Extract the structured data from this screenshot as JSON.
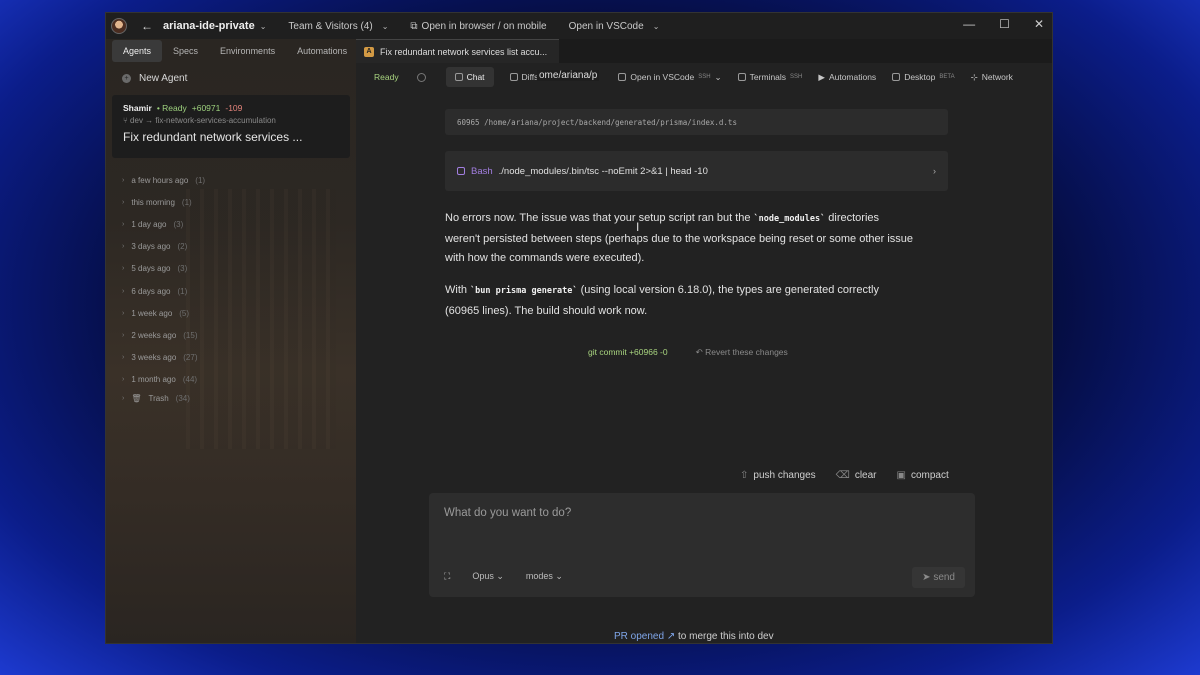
{
  "titlebar": {
    "repo": "ariana-ide-private",
    "team": "Team & Visitors (4)",
    "open_browser": "Open in browser / on mobile",
    "open_vscode": "Open in VSCode"
  },
  "sidebar": {
    "tabs": [
      "Agents",
      "Specs",
      "Environments",
      "Automations"
    ],
    "new_agent": "New Agent",
    "agent": {
      "name": "Shamir",
      "status": "• Ready",
      "added": "+60971",
      "removed": "-109",
      "branch": "dev → fix-network-services-accumulation",
      "title": "Fix redundant network services ..."
    },
    "groups": [
      {
        "label": "a few hours ago",
        "count": "(1)"
      },
      {
        "label": "this morning",
        "count": "(1)"
      },
      {
        "label": "1 day ago",
        "count": "(3)"
      },
      {
        "label": "3 days ago",
        "count": "(2)"
      },
      {
        "label": "5 days ago",
        "count": "(3)"
      },
      {
        "label": "6 days ago",
        "count": "(1)"
      },
      {
        "label": "1 week ago",
        "count": "(5)"
      },
      {
        "label": "2 weeks ago",
        "count": "(15)"
      },
      {
        "label": "3 weeks ago",
        "count": "(27)"
      },
      {
        "label": "1 month ago",
        "count": "(44)"
      },
      {
        "label": "Trash",
        "count": "(34)"
      }
    ]
  },
  "main": {
    "file_tab": "Fix redundant network services list accu...",
    "status": "Ready",
    "tools": {
      "chat": "Chat",
      "diffs": "Diffs",
      "path": "ome/ariana/p",
      "open_vscode": "Open in VSCode",
      "ssh": "SSH",
      "terminals": "Terminals",
      "automations": "Automations",
      "desktop": "Desktop",
      "beta": "BETA",
      "network": "Network"
    },
    "code_line": "60965 /home/ariana/project/backend/generated/prisma/index.d.ts",
    "bash_label": "Bash",
    "bash_cmd": "./node_modules/.bin/tsc --noEmit 2>&1 | head -10",
    "p1_a": "No errors now. The issue was that your setup script ran but the ",
    "p1_code": "`node_modules`",
    "p1_b": " directories weren't persisted between steps (perhaps due to the workspace being reset or some other issue with how the commands were executed).",
    "p2_a": "With ",
    "p2_code": "`bun prisma generate`",
    "p2_b": " (using local version 6.18.0), the types are generated correctly (60965 lines). The build should work now.",
    "commit": "git commit +60966 -0",
    "revert": "Revert these changes",
    "actions": {
      "push": "push changes",
      "clear": "clear",
      "compact": "compact"
    },
    "input_placeholder": "What do you want to do?",
    "model": "Opus",
    "modes": "modes",
    "send": "send",
    "pr_opened": "PR opened",
    "pr_rest": "to merge this into dev"
  }
}
